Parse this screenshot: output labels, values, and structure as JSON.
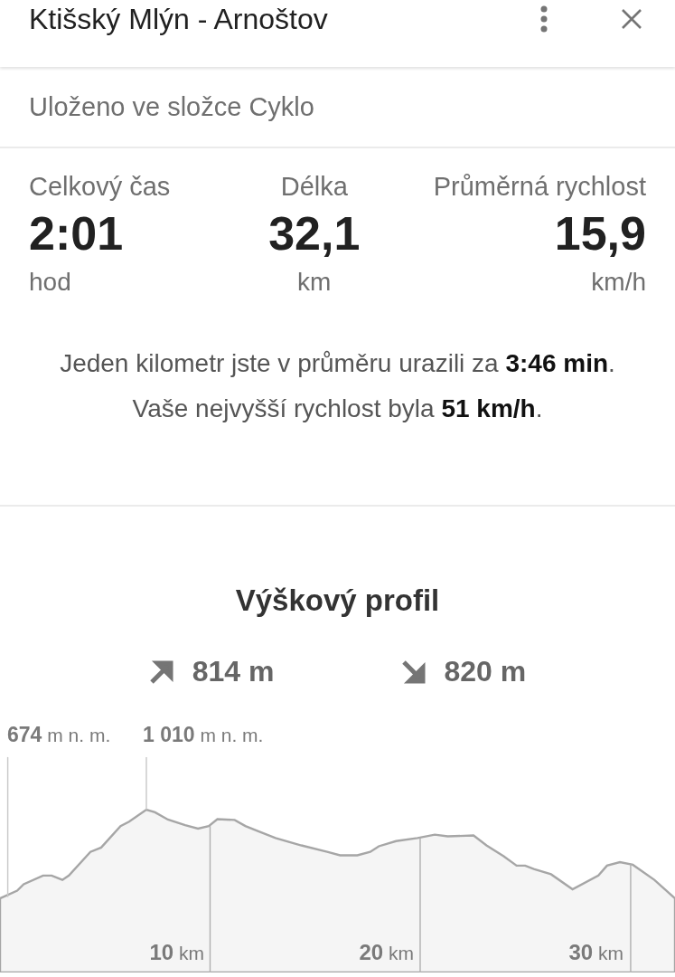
{
  "header": {
    "title": "Ktišský Mlýn - Arnoštov"
  },
  "folder": "Uloženo ve složce Cyklo",
  "stats": [
    {
      "label": "Celkový čas",
      "value": "2:01",
      "unit": "hod"
    },
    {
      "label": "Délka",
      "value": "32,1",
      "unit": "km"
    },
    {
      "label": "Průměrná rychlost",
      "value": "15,9",
      "unit": "km/h"
    }
  ],
  "summary": [
    "Jeden kilometr jste v průměru urazili za **3:46 min**.",
    "Vaše nejvyšší rychlost byla **51 km/h**."
  ],
  "elevation": {
    "title": "Výškový profil",
    "ascent": "814 m",
    "descent": "820 m",
    "markers": [
      "**674** m n. m.",
      "**1 010** m n. m."
    ],
    "distance_ticks": [
      "**10** km",
      "**20** km",
      "**30** km"
    ]
  }
}
